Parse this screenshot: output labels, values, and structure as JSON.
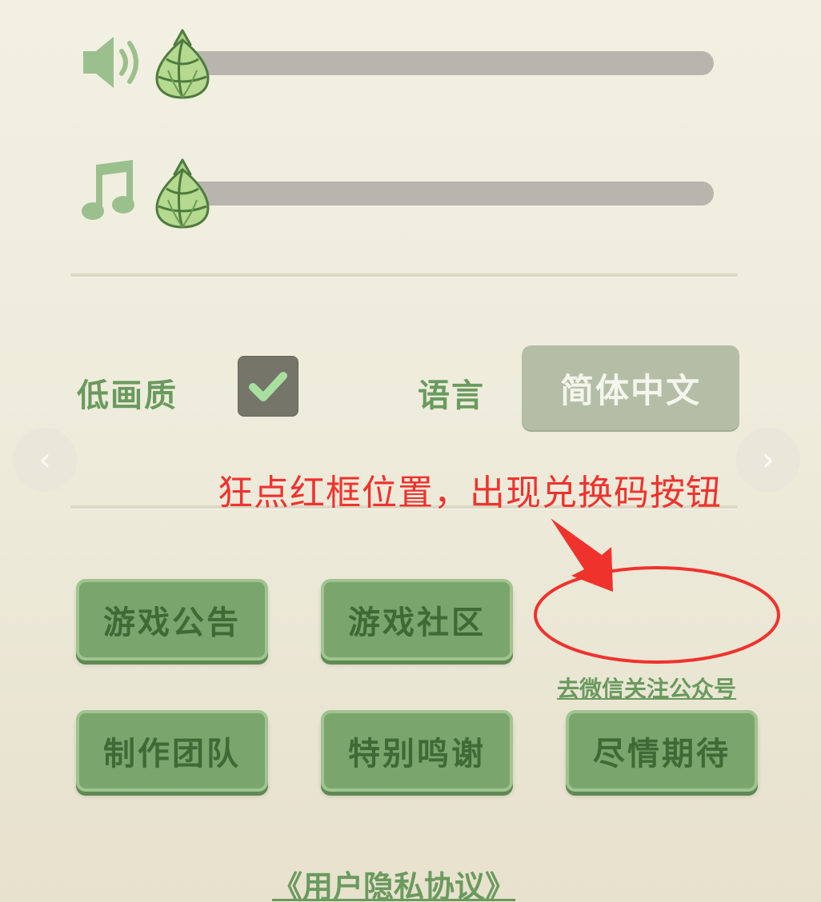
{
  "sliders": {
    "sound_volume": 0.0,
    "music_volume": 0.0,
    "sound_icon": "speaker-icon",
    "music_icon": "music-note-icon",
    "thumb_icon": "hop-cone-icon"
  },
  "settings": {
    "low_quality_label": "低画质",
    "low_quality_checked": true,
    "language_label": "语言",
    "language_value": "简体中文"
  },
  "annotation": {
    "text": "狂点红框位置，出现兑换码按钮",
    "color": "#f0322d"
  },
  "buttons": {
    "game_notice": "游戏公告",
    "game_community": "游戏社区",
    "production_team": "制作团队",
    "special_thanks": "特别鸣谢",
    "stay_tuned": "尽情期待"
  },
  "links": {
    "wechat_follow": "去微信关注公众号",
    "privacy": "《用户隐私协议》"
  },
  "colors": {
    "background": "#f0eee0",
    "accent_green": "#6a9a5e",
    "button_green": "#7aa56d",
    "button_text": "#3f6a35",
    "track_gray": "#b7b5ad"
  }
}
